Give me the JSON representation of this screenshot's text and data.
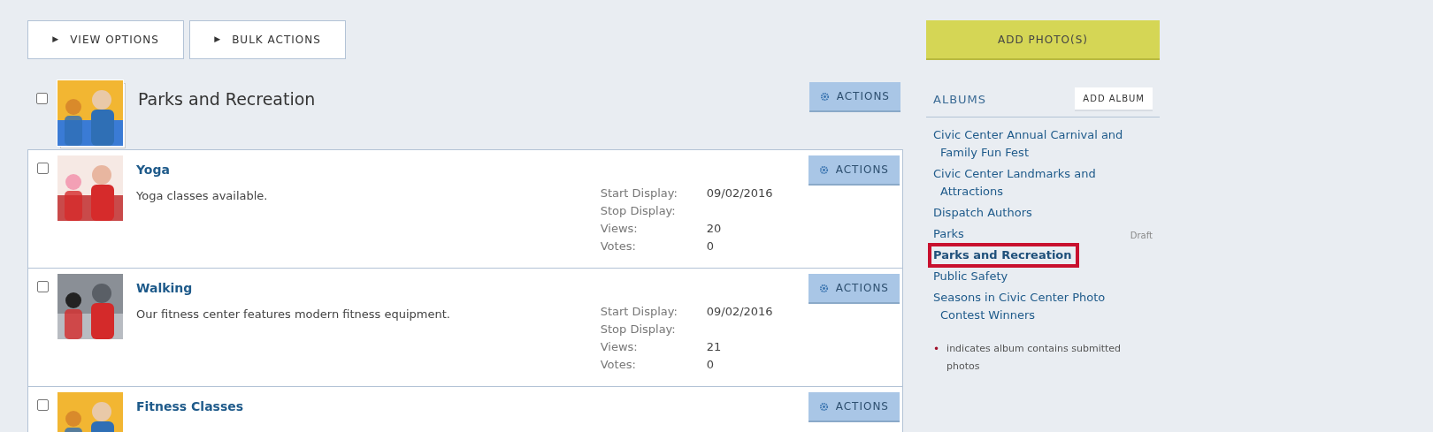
{
  "toolbar": [
    {
      "label": "VIEW OPTIONS",
      "icon": "▶"
    },
    {
      "label": "BULK ACTIONS",
      "icon": "▶"
    }
  ],
  "album": {
    "title": "Parks and Recreation",
    "checked": false,
    "actions_label": "ACTIONS"
  },
  "photos": [
    {
      "title": "Yoga",
      "description": "Yoga classes available.",
      "checked": false,
      "actions_label": "ACTIONS",
      "details": [
        {
          "label": "Start Display:",
          "value": "09/02/2016"
        },
        {
          "label": "Stop Display:"
        },
        {
          "label": "Views:",
          "value": "20"
        },
        {
          "label": "Votes:",
          "value": "0"
        }
      ]
    },
    {
      "title": "Walking",
      "description": "Our fitness center features modern fitness equipment.",
      "checked": false,
      "actions_label": "ACTIONS",
      "details": [
        {
          "label": "Start Display:",
          "value": "09/02/2016"
        },
        {
          "label": "Stop Display:"
        },
        {
          "label": "Views:",
          "value": "21"
        },
        {
          "label": "Votes:",
          "value": "0"
        }
      ]
    },
    {
      "title": "Fitness Classes",
      "checked": false,
      "actions_label": "ACTIONS"
    }
  ],
  "sidebar": {
    "add_photos": "ADD PHOTO(S)",
    "albums_heading": "ALBUMS",
    "add_album": "ADD ALBUM",
    "albums": [
      {
        "name": "Civic Center Annual Carnival and Family Fun Fest",
        "selected": false
      },
      {
        "name": "Civic Center Landmarks and Attractions",
        "selected": false
      },
      {
        "name": "Dispatch Authors",
        "selected": false
      },
      {
        "name": "Parks",
        "selected": false,
        "tag": "Draft"
      },
      {
        "name": "Parks and Recreation",
        "selected": true
      },
      {
        "name": "Public Safety",
        "selected": false
      },
      {
        "name": "Seasons in Civic Center Photo Contest Winners",
        "selected": false
      }
    ],
    "legend": {
      "marker": "•",
      "text": "indicates album contains submitted photos"
    }
  }
}
